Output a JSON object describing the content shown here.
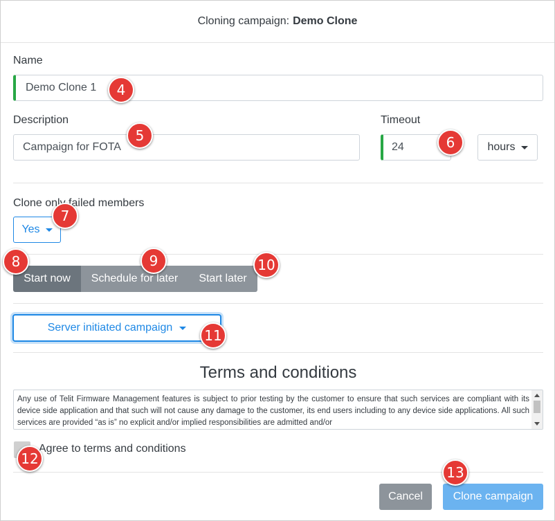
{
  "dialog": {
    "title_prefix": "Cloning campaign:",
    "title_name": "Demo Clone"
  },
  "form": {
    "name_label": "Name",
    "name_value": "Demo Clone 1",
    "description_label": "Description",
    "description_value": "Campaign for FOTA",
    "timeout_label": "Timeout",
    "timeout_value": "24",
    "timeout_unit": "hours",
    "clone_failed_label": "Clone only failed members",
    "clone_failed_value": "Yes"
  },
  "schedule": {
    "options": [
      "Start now",
      "Schedule for later",
      "Start later"
    ],
    "selected": "Start now"
  },
  "campaign_type": "Server initiated campaign",
  "terms": {
    "title": "Terms and conditions",
    "text": "Any use of Telit Firmware Management features is subject to prior testing by the customer to ensure that such services are compliant with its device side application and that such will not cause any damage to the customer, its end users including to any device side applications. All such services are provided “as is” no explicit and/or implied responsibilities are admitted and/or",
    "agree_label": "Agree to terms and conditions",
    "agreed": false
  },
  "footer": {
    "cancel_label": "Cancel",
    "clone_label": "Clone campaign"
  },
  "badges": [
    "4",
    "5",
    "6",
    "7",
    "8",
    "9",
    "10",
    "11",
    "12",
    "13"
  ],
  "colors": {
    "primary": "#1e88e5",
    "valid": "#28a745",
    "secondary": "#6c757d",
    "badge": "#e53935"
  }
}
